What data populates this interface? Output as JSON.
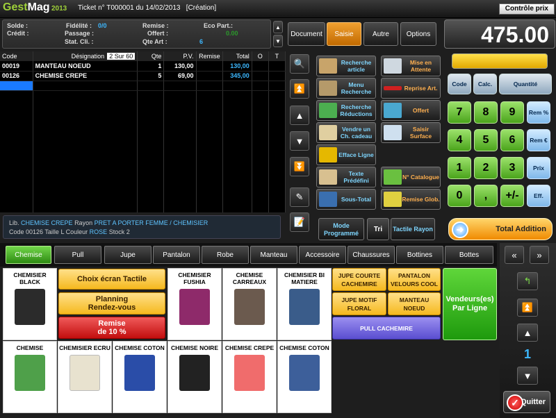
{
  "app": {
    "logo_gest": "Gest",
    "logo_mag": "Mag",
    "year": "2013",
    "ticket": "Ticket n° T000001 du 14/02/2013",
    "status": "[Création]",
    "controle_prix": "Contrôle prix"
  },
  "info": {
    "solde_label": "Solde :",
    "credit_label": "Crédit :",
    "fidelite_label": "Fidélité :",
    "fidelite_value": "0/0",
    "passage_label": "Passage :",
    "statcli_label": "Stat. Cli. :",
    "remise_label": "Remise :",
    "offert_label": "Offert :",
    "qteart_label": "Qte Art :",
    "qteart_value": "6",
    "ecopart_label": "Eco Part.:",
    "ecopart_value": "0.00"
  },
  "grid": {
    "headers": [
      "Code",
      "Désignation",
      "Qte",
      "P.V.",
      "Remise",
      "Total",
      "O",
      "T"
    ],
    "page_indicator": "2 Sur 60",
    "rows": [
      {
        "code": "00019",
        "designation": "MANTEAU NOEUD",
        "qte": "1",
        "pv": "130,00",
        "remise": "",
        "total": "130,00"
      },
      {
        "code": "00126",
        "designation": "CHEMISE CREPE",
        "qte": "5",
        "pv": "69,00",
        "remise": "",
        "total": "345,00"
      }
    ]
  },
  "lib": {
    "lib_label": "Lib.",
    "lib_value": "CHEMISE CREPE",
    "rayon_label": "Rayon",
    "rayon_value": "PRET A PORTER FEMME / CHEMISIER",
    "code_label": "Code",
    "code_value": "00126",
    "taille_label": "Taille",
    "taille_value": "L",
    "couleur_label": "Couleur",
    "couleur_value": "ROSE",
    "stock_label": "Stock",
    "stock_value": "2"
  },
  "tabs": [
    "Document",
    "Saisie",
    "Autre",
    "Options"
  ],
  "total": "475.00",
  "functions_left": [
    "Recherche article",
    "Menu Recherche",
    "Recherche Réductions",
    "Vendre un Ch. cadeau",
    "Efface Ligne",
    "Texte Prédéfini",
    "Sous-Total"
  ],
  "functions_right": [
    "Mise en Attente",
    "Reprise Art.",
    "Offert",
    "Saisir Surface",
    "N° Catalogue",
    "Remise Glob."
  ],
  "keypad": {
    "top": [
      "Code",
      "Calc.",
      "Quantité"
    ],
    "digits": [
      "7",
      "8",
      "9",
      "4",
      "5",
      "6",
      "1",
      "2",
      "3",
      "0",
      ",",
      "+/-"
    ],
    "side": [
      "Rem %",
      "Rem €",
      "Prix",
      "Eff."
    ]
  },
  "bottom": {
    "mode_prog": "Mode Programmé",
    "tri": "Tri",
    "tactile_rayon": "Tactile Rayon",
    "total_addition": "Total Addition"
  },
  "categories": [
    "Chemise",
    "Pull",
    "Jupe",
    "Pantalon",
    "Robe",
    "Manteau",
    "Accessoire",
    "Chaussures",
    "Bottines",
    "Bottes"
  ],
  "products_row1": [
    {
      "name": "CHEMISIER BLACK",
      "color": "#2b2b2b"
    },
    {
      "name": "CHEMISIER FUSHIA",
      "color": "#8e2a6a"
    },
    {
      "name": "CHEMISE CARREAUX",
      "color": "#6b5a4e"
    },
    {
      "name": "CHEMISIER BI MATIERE",
      "color": "#3a5c8a"
    }
  ],
  "products_row2": [
    {
      "name": "CHEMISE",
      "color": "#4fa04a"
    },
    {
      "name": "CHEMISIER ECRU",
      "color": "#e8e2cf"
    },
    {
      "name": "CHEMISE COTON",
      "color": "#2a4da8"
    },
    {
      "name": "CHEMISE NOIRE",
      "color": "#222222"
    },
    {
      "name": "CHEMISE CREPE",
      "color": "#f06c6c"
    },
    {
      "name": "CHEMISE COTON",
      "color": "#3d5f9a"
    }
  ],
  "actions": {
    "choix_ecran": "Choix écran Tactile",
    "planning": "Planning\nRendez-vous",
    "remise10": "Remise\nde 10 %"
  },
  "small_buttons": [
    "JUPE COURTE CACHEMIRE",
    "PANTALON VELOURS COOL",
    "JUPE MOTIF FLORAL",
    "MANTEAU NOEUD",
    "PULL CACHEMIRE"
  ],
  "vendeurs": "Vendeurs(es) Par Ligne",
  "page_number": "1",
  "quitter": "Quitter"
}
